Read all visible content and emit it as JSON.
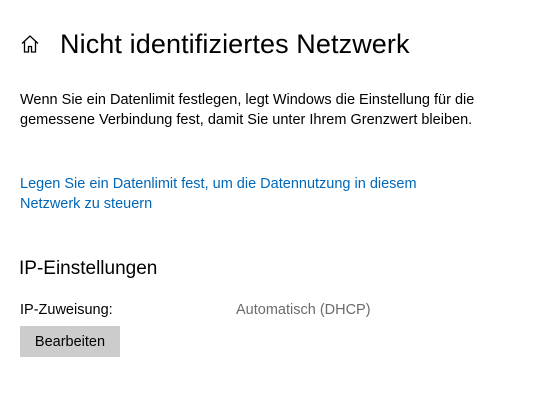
{
  "header": {
    "home_icon": "home-icon",
    "title": "Nicht identifiziertes Netzwerk"
  },
  "description": "Wenn Sie ein Datenlimit festlegen, legt Windows die Einstellung für die gemessene Verbindung fest, damit Sie unter Ihrem Grenzwert bleiben.",
  "data_limit_link": "Legen Sie ein Datenlimit fest, um die Datennutzung in diesem Netzwerk zu steuern",
  "ip_settings": {
    "section_title": "IP-Einstellungen",
    "assignment_label": "IP-Zuweisung:",
    "assignment_value": "Automatisch (DHCP)",
    "edit_button_label": "Bearbeiten"
  },
  "colors": {
    "link": "#0067b8",
    "secondary_text": "#6b6b6b",
    "button_bg": "#cccccc"
  }
}
